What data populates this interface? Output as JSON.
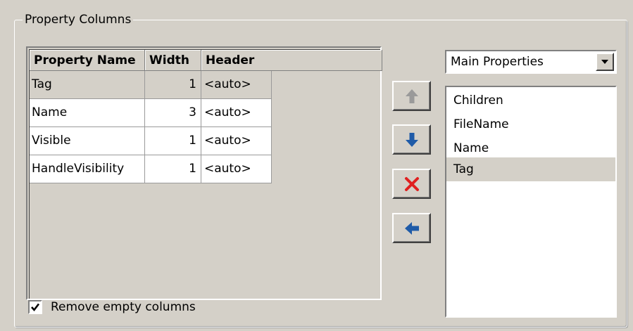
{
  "group": {
    "title": "Property Columns"
  },
  "table": {
    "columns": [
      "Property Name",
      "Width",
      "Header"
    ],
    "rows": [
      {
        "name": "Tag",
        "width": "1",
        "header": "<auto>",
        "selected": true
      },
      {
        "name": "Name",
        "width": "3",
        "header": "<auto>",
        "selected": false
      },
      {
        "name": "Visible",
        "width": "1",
        "header": "<auto>",
        "selected": false
      },
      {
        "name": "HandleVisibility",
        "width": "1",
        "header": "<auto>",
        "selected": false
      }
    ]
  },
  "buttons": {
    "move_up_icon": "arrow-up-icon",
    "move_down_icon": "arrow-down-icon",
    "remove_icon": "red-x-icon",
    "add_icon": "arrow-left-icon"
  },
  "dropdown": {
    "selected": "Main Properties"
  },
  "list": {
    "items": [
      {
        "label": "Children",
        "selected": false
      },
      {
        "label": "FileName",
        "selected": false
      },
      {
        "label": "Name",
        "selected": false
      },
      {
        "label": "Tag",
        "selected": true
      }
    ]
  },
  "options": {
    "remove_empty_label": "Remove empty columns",
    "remove_empty_checked": true
  },
  "colors": {
    "background": "#d4d0c8",
    "arrow_blue": "#1f5ba8",
    "remove_red": "#e02020",
    "disabled_gray": "#9a9a9a"
  }
}
